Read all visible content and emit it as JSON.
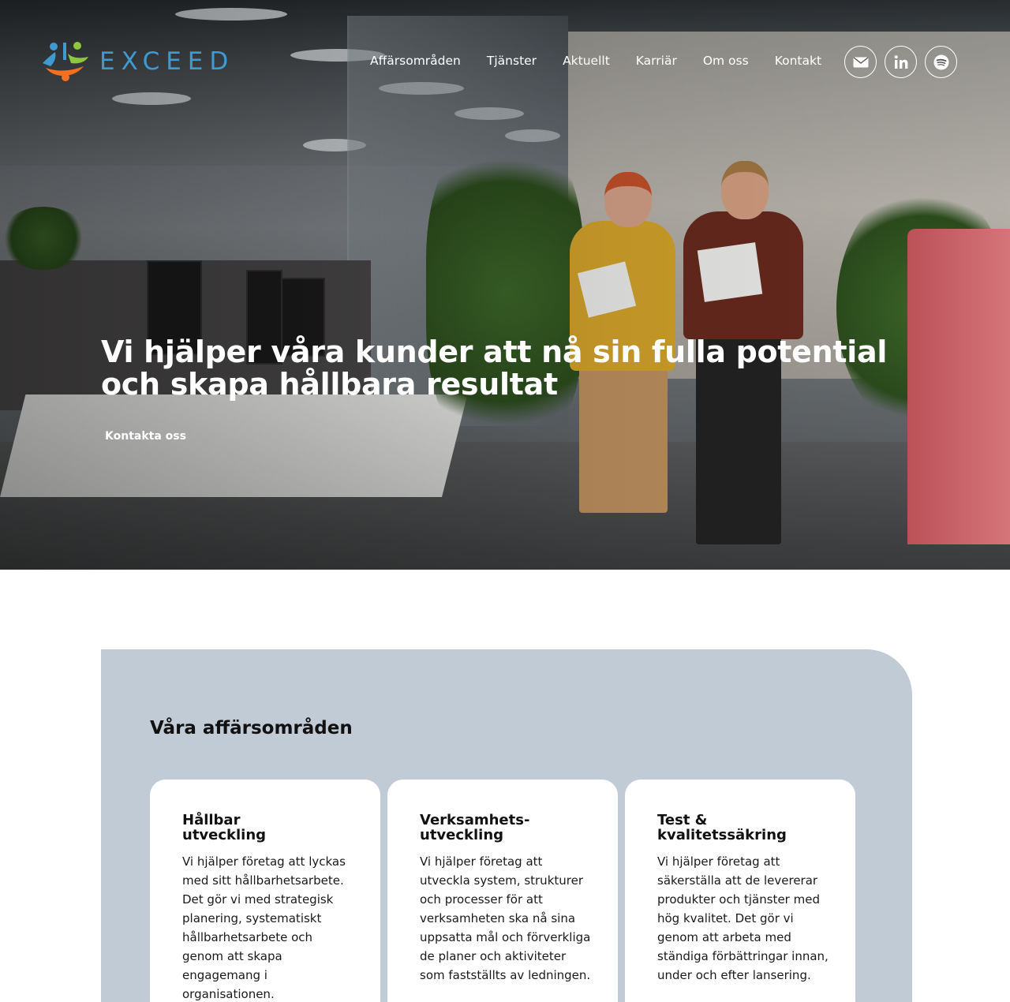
{
  "brand": {
    "name": "EXCEED",
    "logo_colors": [
      "#3f9ad1",
      "#8dc63f",
      "#f37021"
    ]
  },
  "nav": {
    "items": [
      {
        "label": "Affärsområden"
      },
      {
        "label": "Tjänster"
      },
      {
        "label": "Aktuellt"
      },
      {
        "label": "Karriär"
      },
      {
        "label": "Om oss"
      },
      {
        "label": "Kontakt"
      }
    ]
  },
  "social": {
    "icons": [
      "mail-icon",
      "linkedin-icon",
      "spotify-icon"
    ]
  },
  "hero": {
    "title_line1": "Vi hjälper våra kunder att nå sin fulla potential",
    "title_line2": "och skapa hållbara resultat",
    "cta_label": "Kontakta oss"
  },
  "section": {
    "title": "Våra affärsområden",
    "background": "#c1cbd6",
    "cards": [
      {
        "title_line1": "Hållbar",
        "title_line2": "utveckling",
        "text": "Vi hjälper företag att lyckas med sitt hållbarhetsarbete. Det gör vi med strategisk planering, systematiskt hållbarhetsarbete och genom att skapa engagemang i organisationen."
      },
      {
        "title_line1": "Verksamhets-",
        "title_line2": "utveckling",
        "text": "Vi hjälper företag att utveckla system, strukturer och processer för att verksamheten ska nå sina uppsatta mål och förverkliga de planer och aktiviteter som fastställts av ledningen."
      },
      {
        "title_line1": "Test &",
        "title_line2": "kvalitetssäkring",
        "text": "Vi hjälper företag att säkerställa att de levererar produkter och tjänster med hög kvalitet. Det gör vi genom att arbeta med ständiga förbättringar innan, under och efter lansering."
      }
    ]
  }
}
